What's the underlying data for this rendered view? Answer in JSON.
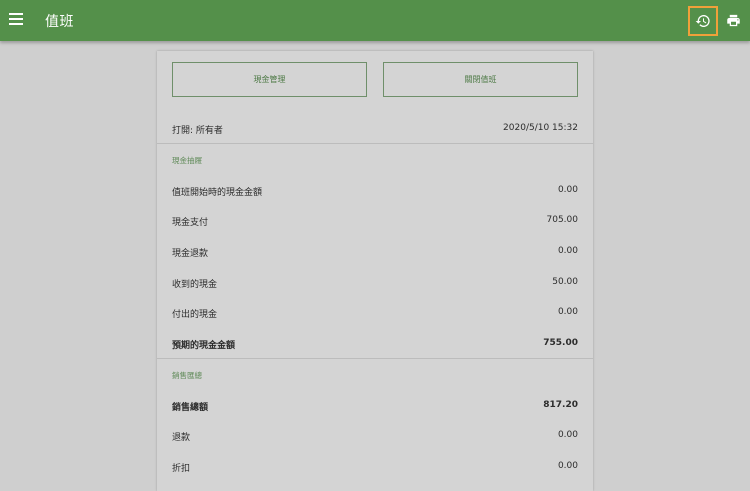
{
  "app": {
    "title": "值班"
  },
  "actions": {
    "cash_management": "現金管理",
    "close_shift": "關閉值班"
  },
  "opened": {
    "label": "打開: 所有者",
    "value": "2020/5/10 15:32"
  },
  "cash_drawer": {
    "title": "現金抽屜",
    "rows": [
      {
        "label": "值班開始時的現金金額",
        "value": "0.00"
      },
      {
        "label": "現金支付",
        "value": "705.00"
      },
      {
        "label": "現金退款",
        "value": "0.00"
      },
      {
        "label": "收到的現金",
        "value": "50.00"
      },
      {
        "label": "付出的現金",
        "value": "0.00"
      },
      {
        "label": "預期的現金金額",
        "value": "755.00"
      }
    ]
  },
  "sales_summary": {
    "title": "銷售匯總",
    "rows": [
      {
        "label": "銷售總額",
        "value": "817.20"
      },
      {
        "label": "退款",
        "value": "0.00"
      },
      {
        "label": "折扣",
        "value": "0.00"
      }
    ]
  },
  "colors": {
    "appbar": "#54904a",
    "highlight": "#f0a03a",
    "accent_text": "#5f8a58"
  },
  "icons": {
    "menu": "menu-icon",
    "history": "history-icon",
    "print": "print-icon"
  }
}
